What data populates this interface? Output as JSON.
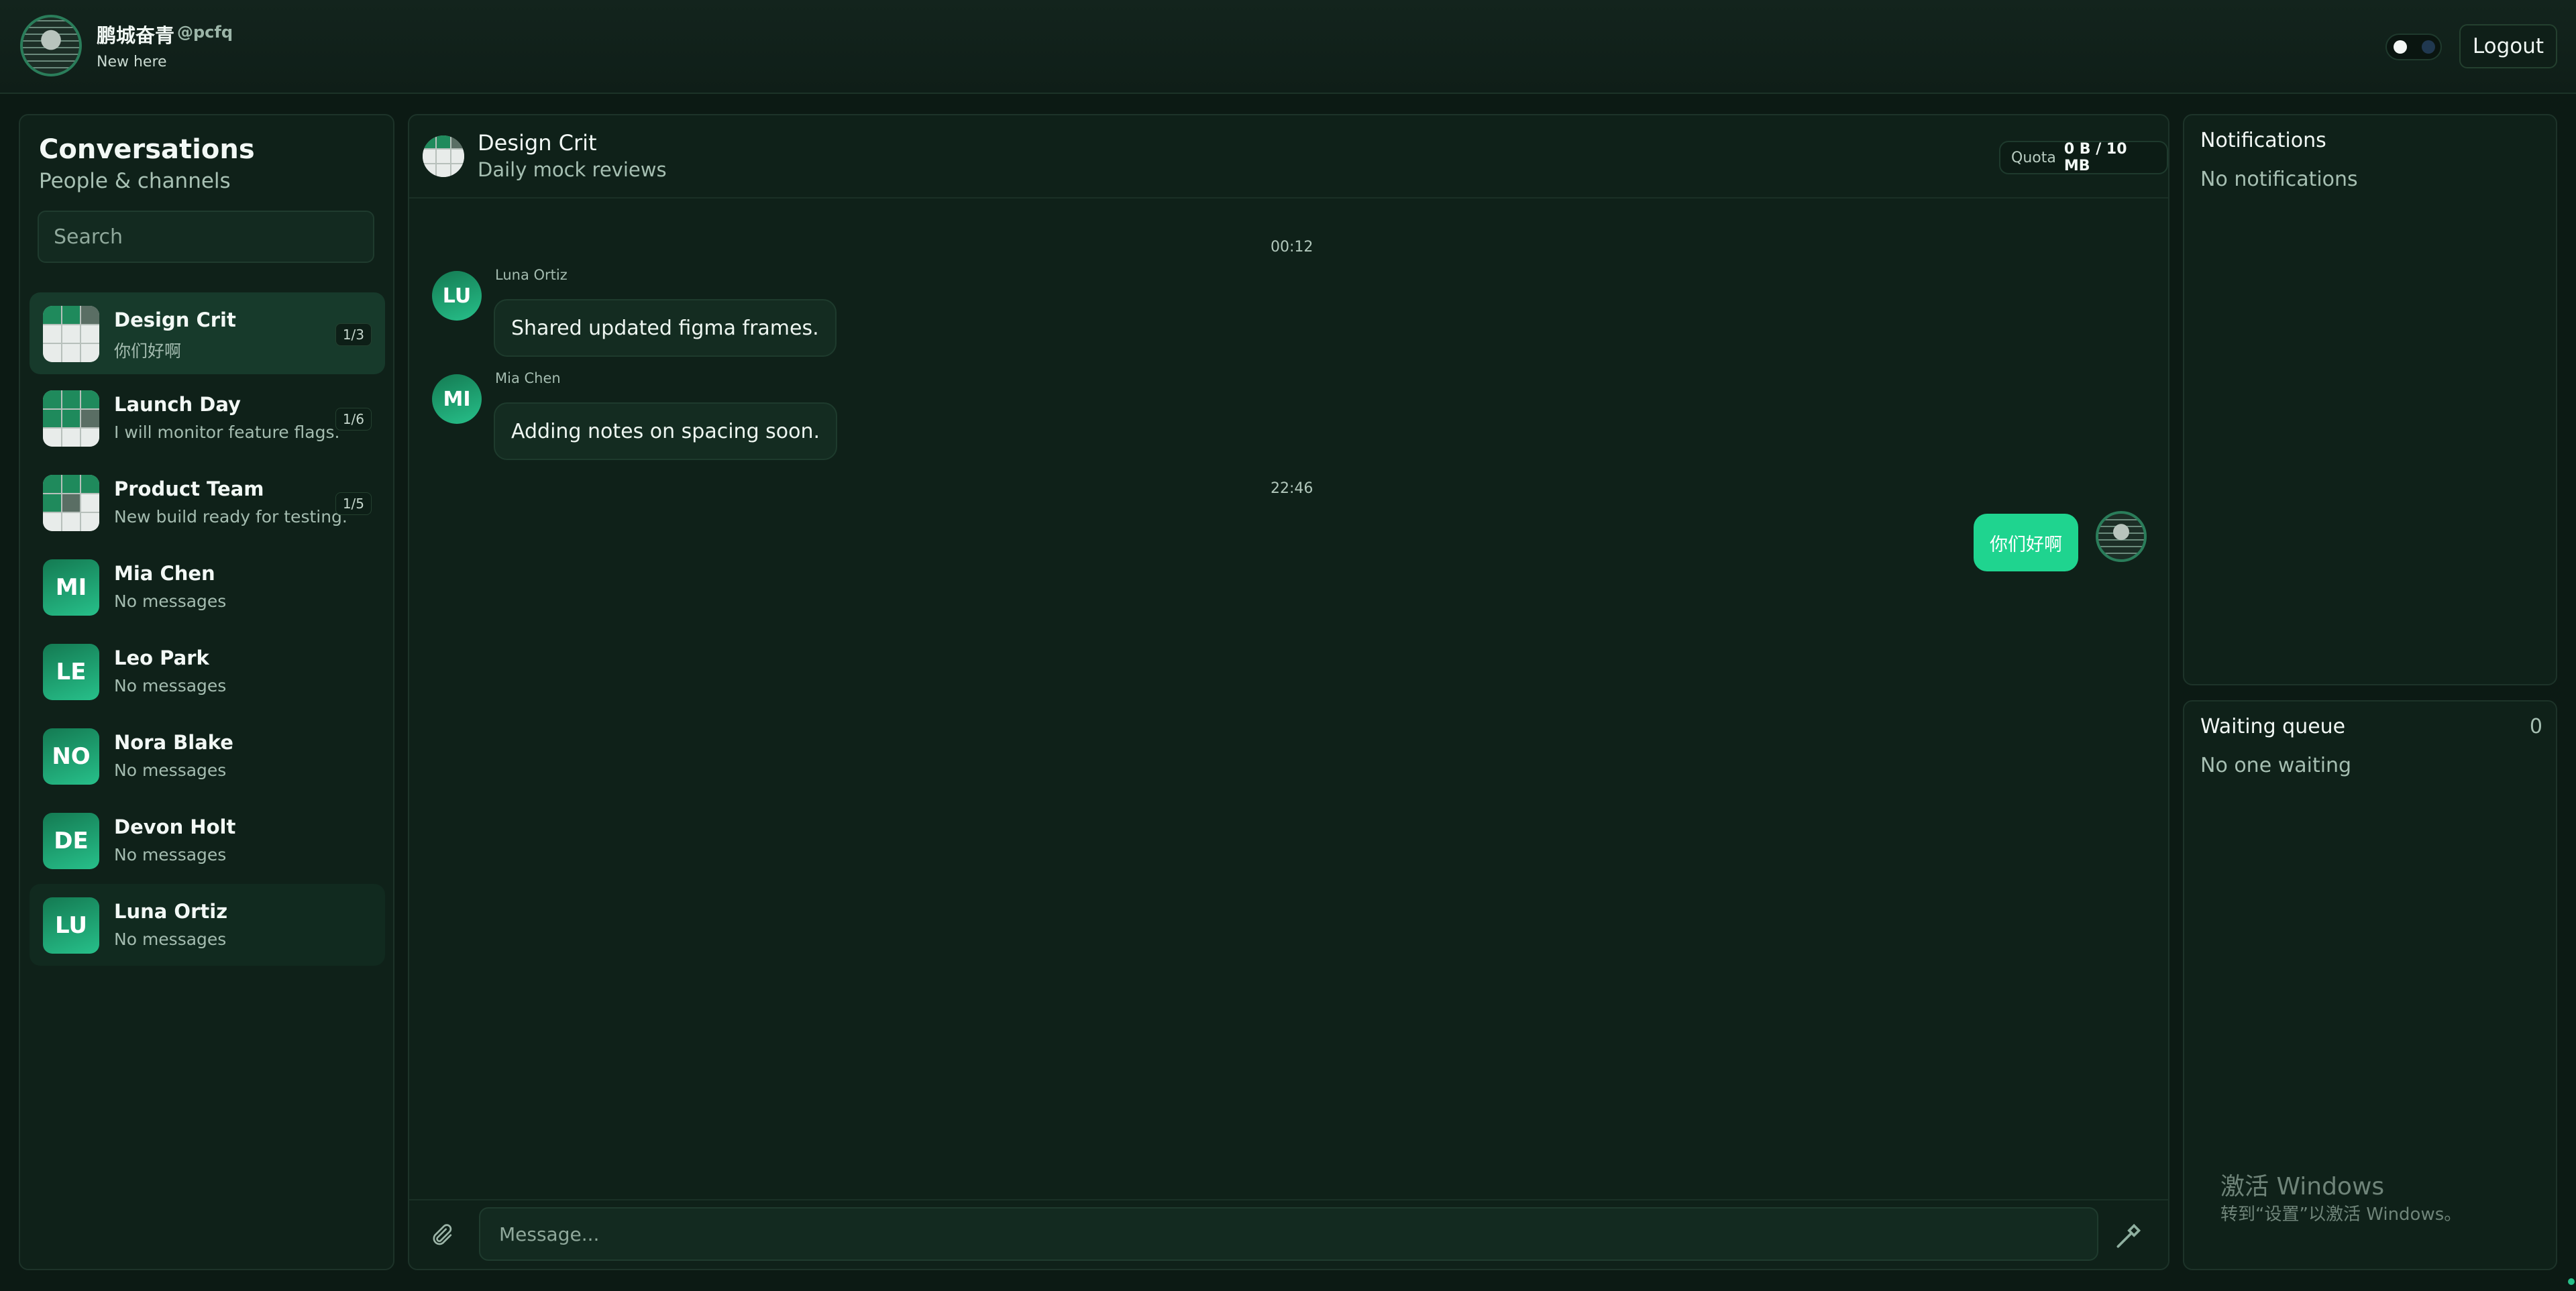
{
  "user": {
    "name": "鹏城奋青",
    "handle": "@pcfq",
    "status": "New here"
  },
  "header": {
    "logout_label": "Logout"
  },
  "sidebar": {
    "title": "Conversations",
    "subtitle": "People & channels",
    "search_placeholder": "Search",
    "conversations": [
      {
        "name": "Design Crit",
        "preview": "你们好啊",
        "count": "1/3",
        "type": "group"
      },
      {
        "name": "Launch Day",
        "preview": "I will monitor feature flags.",
        "count": "1/6",
        "type": "group"
      },
      {
        "name": "Product Team",
        "preview": "New build ready for testing.",
        "count": "1/5",
        "type": "group"
      },
      {
        "name": "Mia Chen",
        "preview": "No messages",
        "initials": "MI"
      },
      {
        "name": "Leo Park",
        "preview": "No messages",
        "initials": "LE"
      },
      {
        "name": "Nora Blake",
        "preview": "No messages",
        "initials": "NO"
      },
      {
        "name": "Devon Holt",
        "preview": "No messages",
        "initials": "DE"
      },
      {
        "name": "Luna Ortiz",
        "preview": "No messages",
        "initials": "LU"
      }
    ]
  },
  "chat": {
    "title": "Design Crit",
    "subtitle": "Daily mock reviews",
    "quota_label": "Quota",
    "quota_value": "0 B / 10 MB",
    "time1": "00:12",
    "time2": "22:46",
    "messages": [
      {
        "sender": "Luna Ortiz",
        "initials": "LU",
        "text": "Shared updated figma frames."
      },
      {
        "sender": "Mia Chen",
        "initials": "MI",
        "text": "Adding notes on spacing soon."
      },
      {
        "sender": "me",
        "text": "你们好啊"
      }
    ],
    "input_placeholder": "Message..."
  },
  "notifications": {
    "title": "Notifications",
    "empty": "No notifications"
  },
  "queue": {
    "title": "Waiting queue",
    "count": "0",
    "empty": "No one waiting"
  },
  "watermark": {
    "line1": "激活 Windows",
    "line2": "转到“设置”以激活 Windows。"
  },
  "colors": {
    "accent": "#1fd48f",
    "background": "#0c1a14",
    "panel": "#0f2119"
  },
  "icons": {
    "attach": "paperclip-icon",
    "send": "send-icon",
    "theme": "theme-toggle-icon"
  }
}
